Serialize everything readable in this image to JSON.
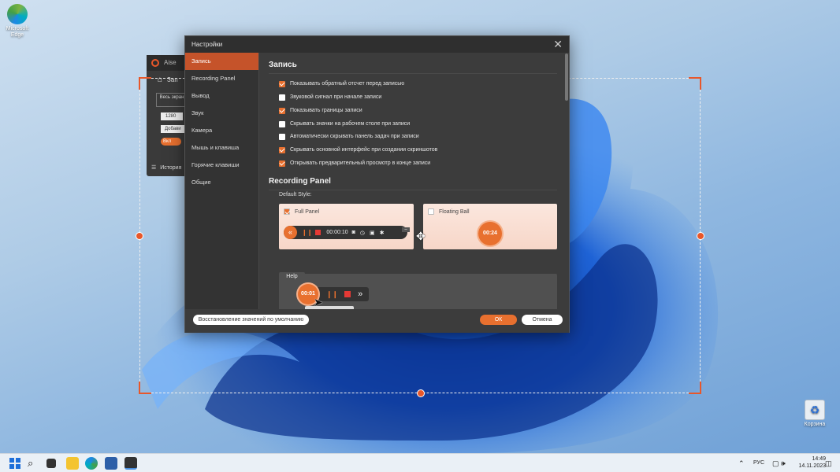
{
  "desktop": {
    "edge_label": "Microsoft Edge",
    "recycle_label": "Корзина"
  },
  "bg_app": {
    "title": "Aise",
    "tab_label": "Зап",
    "fullscreen_label": "Весь экран",
    "width_value": "1280",
    "add_label": "Добави",
    "toggle_label": "Вкл",
    "history_label": "История"
  },
  "dialog": {
    "title": "Настройки",
    "sidebar": [
      {
        "label": "Запись"
      },
      {
        "label": "Recording Panel"
      },
      {
        "label": "Вывод"
      },
      {
        "label": "Звук"
      },
      {
        "label": "Камера"
      },
      {
        "label": "Мышь и клавиша"
      },
      {
        "label": "Горячие клавиши"
      },
      {
        "label": "Общие"
      }
    ],
    "record_section": {
      "heading": "Запись",
      "options": [
        {
          "label": "Показывать обратный отсчет перед записью",
          "checked": true
        },
        {
          "label": "Звуковой сигнал при начале записи",
          "checked": false
        },
        {
          "label": "Показывать границы записи",
          "checked": true
        },
        {
          "label": "Скрывать значки на рабочем столе при записи",
          "checked": false
        },
        {
          "label": "Автоматически скрывать панель задач при записи",
          "checked": false
        },
        {
          "label": "Скрывать основной интерфейс при создании скриншотов",
          "checked": true
        },
        {
          "label": "Открывать предварительный просмотр в конце записи",
          "checked": true
        }
      ]
    },
    "panel_section": {
      "heading": "Recording Panel",
      "default_style_label": "Default Style:",
      "full_panel_label": "Full Panel",
      "full_panel_checked": true,
      "full_panel_time": "00:00:10",
      "floating_ball_label": "Floating Ball",
      "floating_ball_checked": false,
      "floating_ball_time": "00:24",
      "help_label": "Help",
      "help_time": "00:01"
    },
    "footer": {
      "restore_label": "Восстановление значений по умолчанию",
      "ok_label": "ОК",
      "cancel_label": "Отмена"
    }
  },
  "taskbar": {
    "lang": "РУС",
    "time": "14:49",
    "date": "14.11.2023"
  },
  "colors": {
    "accent": "#e8702f",
    "selection": "#e8572a",
    "dialog_bg": "#3c3c3c"
  }
}
